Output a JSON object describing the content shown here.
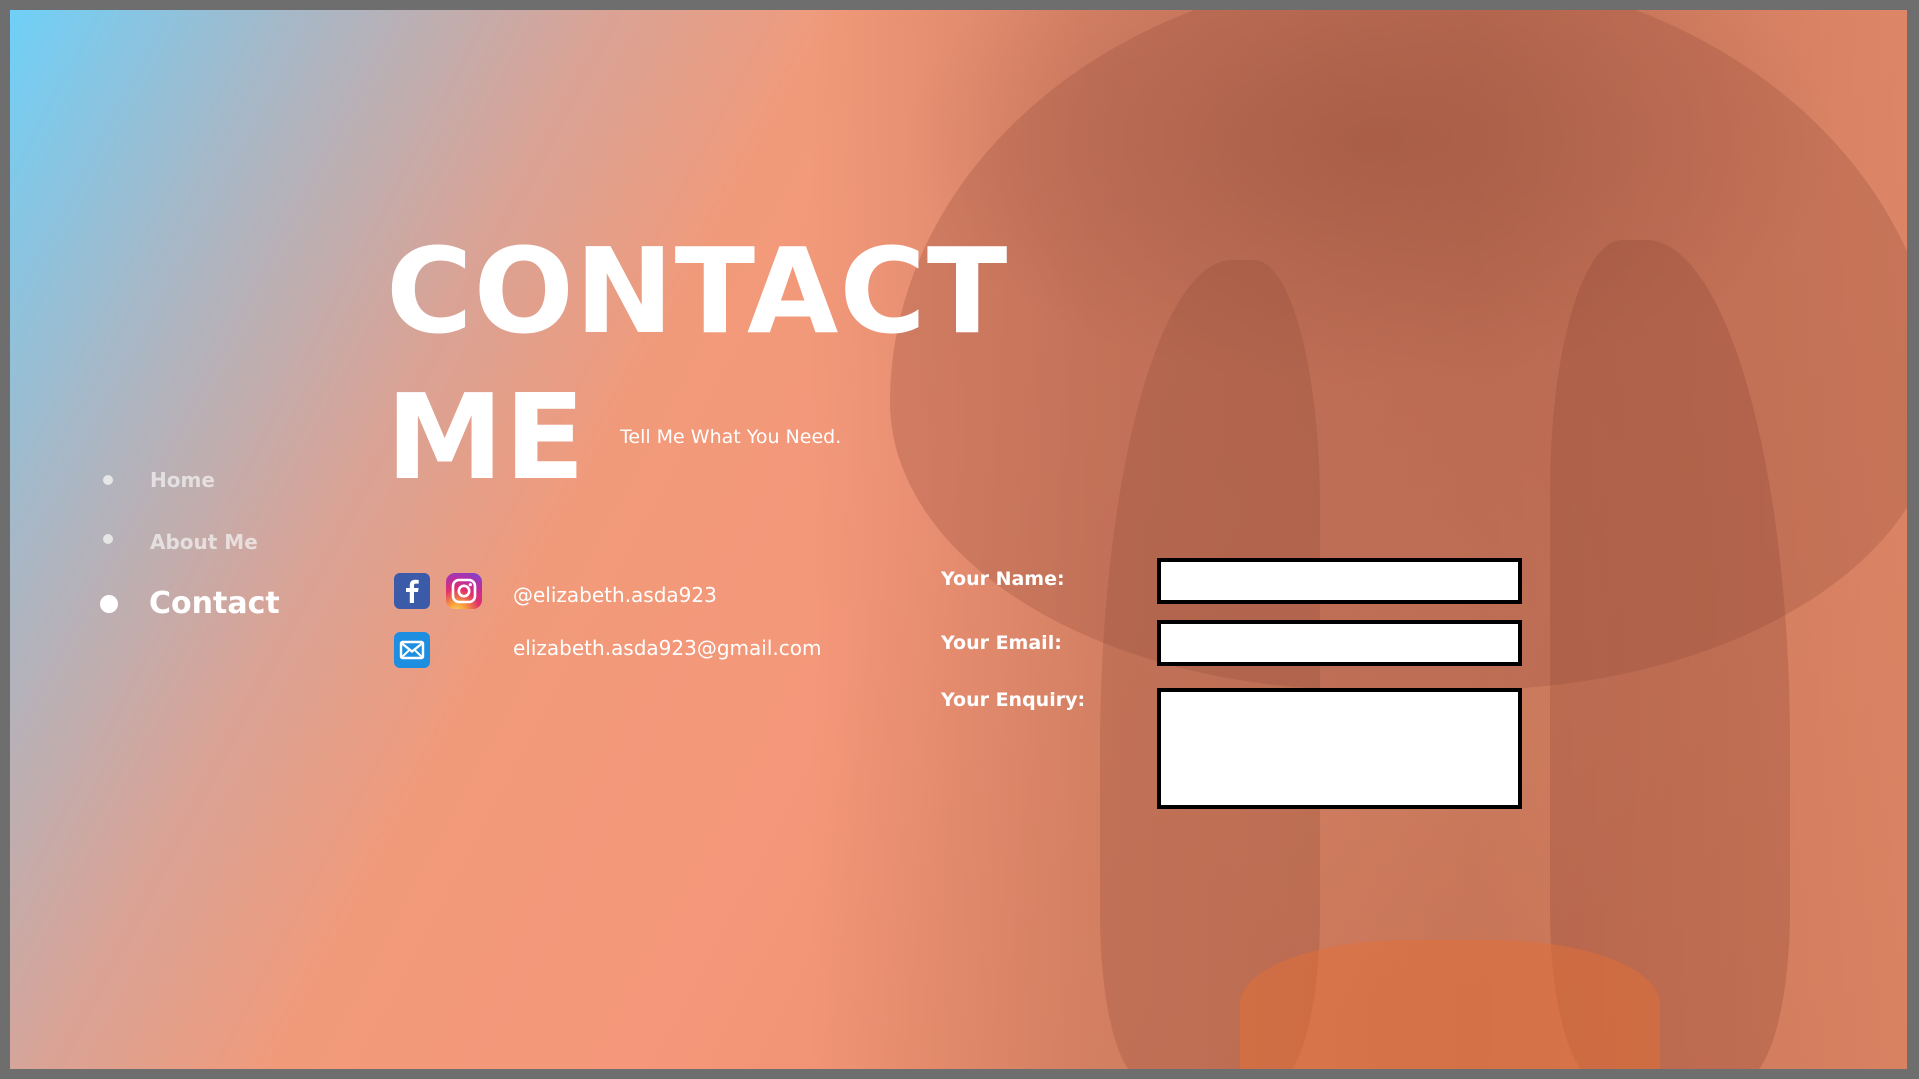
{
  "nav": {
    "items": [
      {
        "label": "Home",
        "active": false
      },
      {
        "label": "About Me",
        "active": false
      },
      {
        "label": "Contact",
        "active": true
      }
    ]
  },
  "hero": {
    "title_line1": "CONTACT",
    "title_line2": "ME",
    "subtitle": "Tell Me What You Need."
  },
  "contact": {
    "social_handle": "@elizabeth.asda923",
    "email": "elizabeth.asda923@gmail.com",
    "icons": [
      "facebook-icon",
      "instagram-icon",
      "mail-icon"
    ]
  },
  "form": {
    "name_label": "Your Name:",
    "email_label": "Your Email:",
    "enquiry_label": "Your Enquiry:",
    "name_value": "",
    "email_value": "",
    "enquiry_value": ""
  },
  "colors": {
    "gradient_start": "#6fd0f8",
    "gradient_main": "#f19a7a",
    "text": "#ffffff",
    "field_border": "#000000",
    "facebook": "#3b5aa8",
    "mail": "#1e8fe0"
  }
}
